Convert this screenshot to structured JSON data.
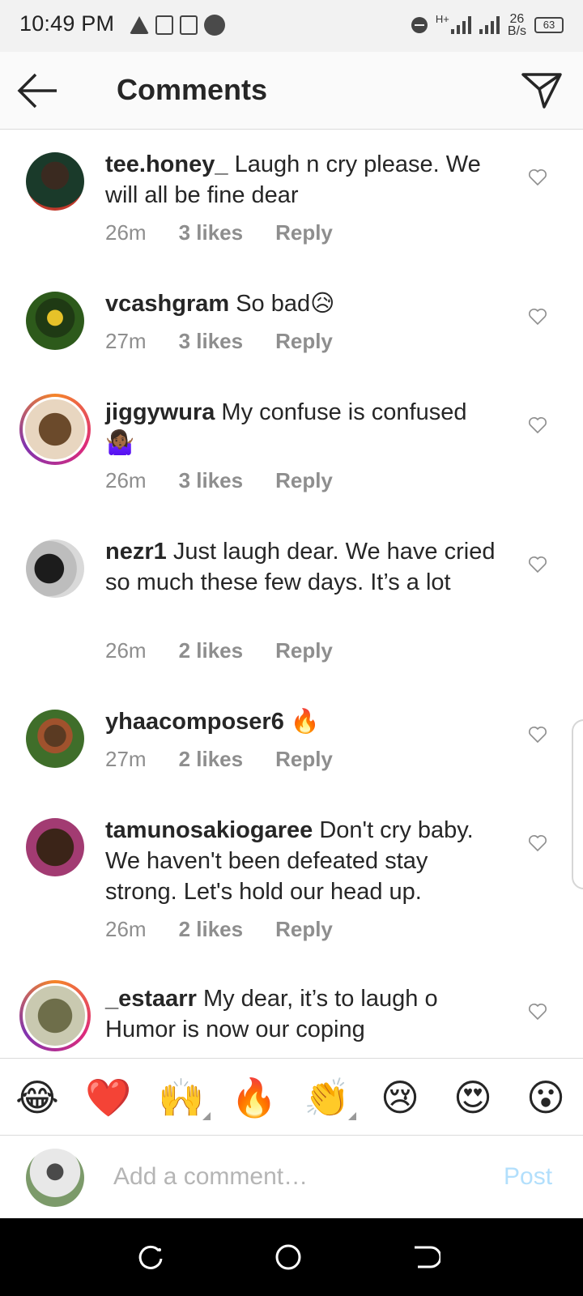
{
  "status_bar": {
    "time": "10:49 PM",
    "network_type": "H+",
    "speed_value": "26",
    "speed_unit": "B/s",
    "battery": "63"
  },
  "header": {
    "title": "Comments",
    "back_icon": "arrow-left-icon",
    "send_icon": "paper-plane-icon"
  },
  "comments": [
    {
      "username": "tee.honey_",
      "text": "Laugh n cry please. We will all be fine dear",
      "time": "26m",
      "likes": "3 likes",
      "reply": "Reply",
      "avatar_colors": [
        "#1a3a2a",
        "#c0392b"
      ]
    },
    {
      "username": "vcashgram",
      "text": "So bad😥",
      "time": "27m",
      "likes": "3 likes",
      "reply": "Reply",
      "avatar_colors": [
        "#2d5a1b",
        "#e6c229"
      ]
    },
    {
      "username": "jiggywura",
      "text": "My confuse is confused 🤷🏾‍♀️",
      "time": "26m",
      "likes": "3 likes",
      "reply": "Reply",
      "avatar_colors": [
        "#6b4a2b",
        "#e8d6c0"
      ],
      "story_ring": true
    },
    {
      "username": "nezr1",
      "text": "Just laugh dear. We have cried so much these few days. It’s a lot",
      "time": "26m",
      "likes": "2 likes",
      "reply": "Reply",
      "avatar_colors": [
        "#1c1c1c",
        "#d9d9d9"
      ]
    },
    {
      "username": "yhaacomposer6",
      "text": "🔥",
      "time": "27m",
      "likes": "2 likes",
      "reply": "Reply",
      "avatar_colors": [
        "#3f6e2a",
        "#a0522d"
      ]
    },
    {
      "username": "tamunosakiogaree",
      "text": "Don't cry baby. We haven't been defeated stay strong. Let's hold our head up.",
      "time": "26m",
      "likes": "2 likes",
      "reply": "Reply",
      "avatar_colors": [
        "#3b2418",
        "#a23b72"
      ]
    },
    {
      "username": "_estaarr",
      "text": "My dear, it’s to laugh o Humor is now our coping",
      "time": "",
      "likes": "",
      "reply": "",
      "avatar_colors": [
        "#6e6e4a",
        "#c9c9b0"
      ],
      "story_ring": true
    }
  ],
  "emoji_bar": [
    "😂",
    "❤️",
    "🙌",
    "🔥",
    "👏",
    "😢",
    "😍",
    "😮"
  ],
  "composer": {
    "placeholder": "Add a comment…",
    "post_label": "Post"
  },
  "nav_bar": {
    "buttons": [
      "recent-apps-icon",
      "home-icon",
      "back-icon"
    ]
  },
  "colors": {
    "accent_disabled": "#b2dffc",
    "meta_gray": "#8e8e8e",
    "text": "#262626"
  }
}
